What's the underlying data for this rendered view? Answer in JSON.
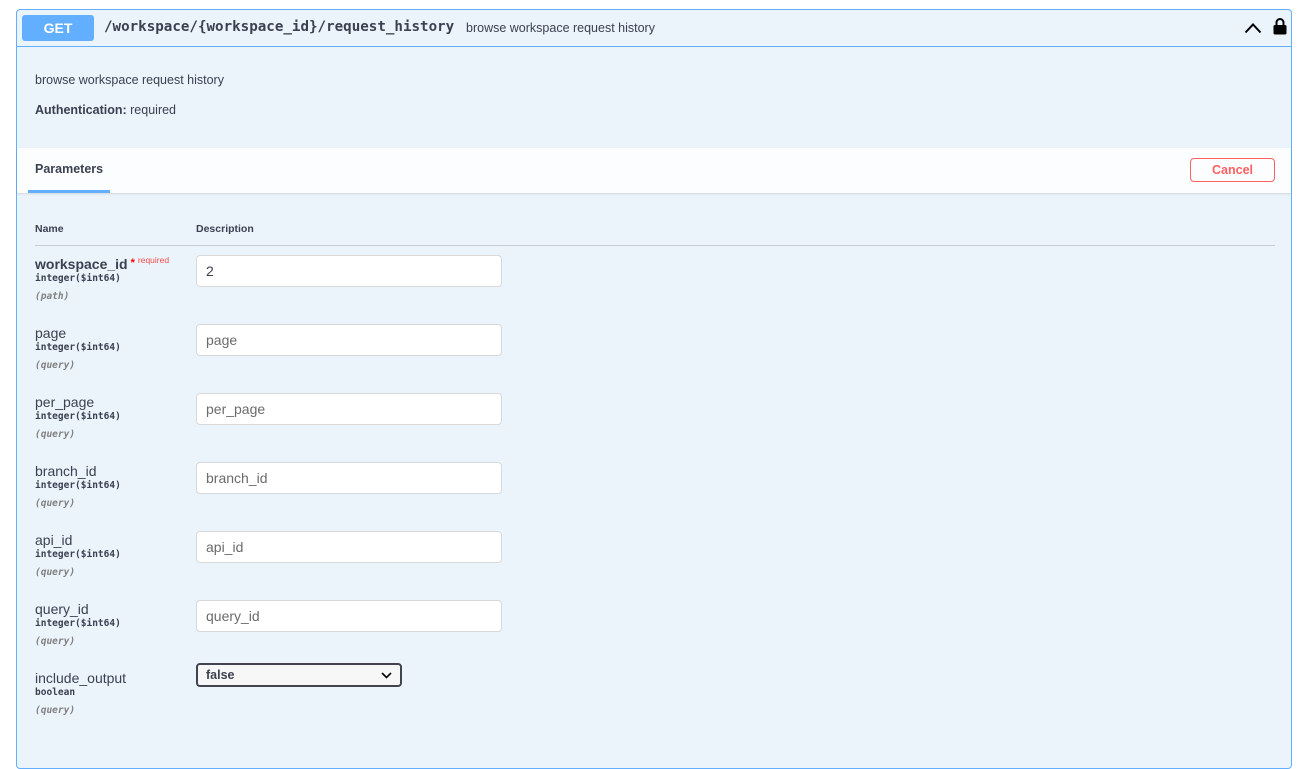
{
  "operation": {
    "method": "GET",
    "path": "/workspace/{workspace_id}/request_history",
    "summary": "browse workspace request history",
    "description": "browse workspace request history",
    "auth_label": "Authentication:",
    "auth_value": " required",
    "collapse_icon": "chevron-up-icon",
    "lock_icon": "lock-icon"
  },
  "parameters_section": {
    "tab_label": "Parameters",
    "cancel_label": "Cancel",
    "col_name": "Name",
    "col_description": "Description"
  },
  "params": [
    {
      "name": "workspace_id",
      "star": "*",
      "required_label": "required",
      "type": "integer($int64)",
      "in": "(path)",
      "value": "2",
      "placeholder": "workspace_id"
    },
    {
      "name": "page",
      "type": "integer($int64)",
      "in": "(query)",
      "value": "",
      "placeholder": "page"
    },
    {
      "name": "per_page",
      "type": "integer($int64)",
      "in": "(query)",
      "value": "",
      "placeholder": "per_page"
    },
    {
      "name": "branch_id",
      "type": "integer($int64)",
      "in": "(query)",
      "value": "",
      "placeholder": "branch_id"
    },
    {
      "name": "api_id",
      "type": "integer($int64)",
      "in": "(query)",
      "value": "",
      "placeholder": "api_id"
    },
    {
      "name": "query_id",
      "type": "integer($int64)",
      "in": "(query)",
      "value": "",
      "placeholder": "query_id"
    },
    {
      "name": "include_output",
      "type": "boolean",
      "in": "(query)",
      "selected": "false",
      "select_icon": "chevron-down-icon"
    }
  ],
  "colors": {
    "get_accent": "#61affe",
    "cancel_red": "#ff6060",
    "required_red": "#ff0000",
    "text": "#3b4151"
  }
}
